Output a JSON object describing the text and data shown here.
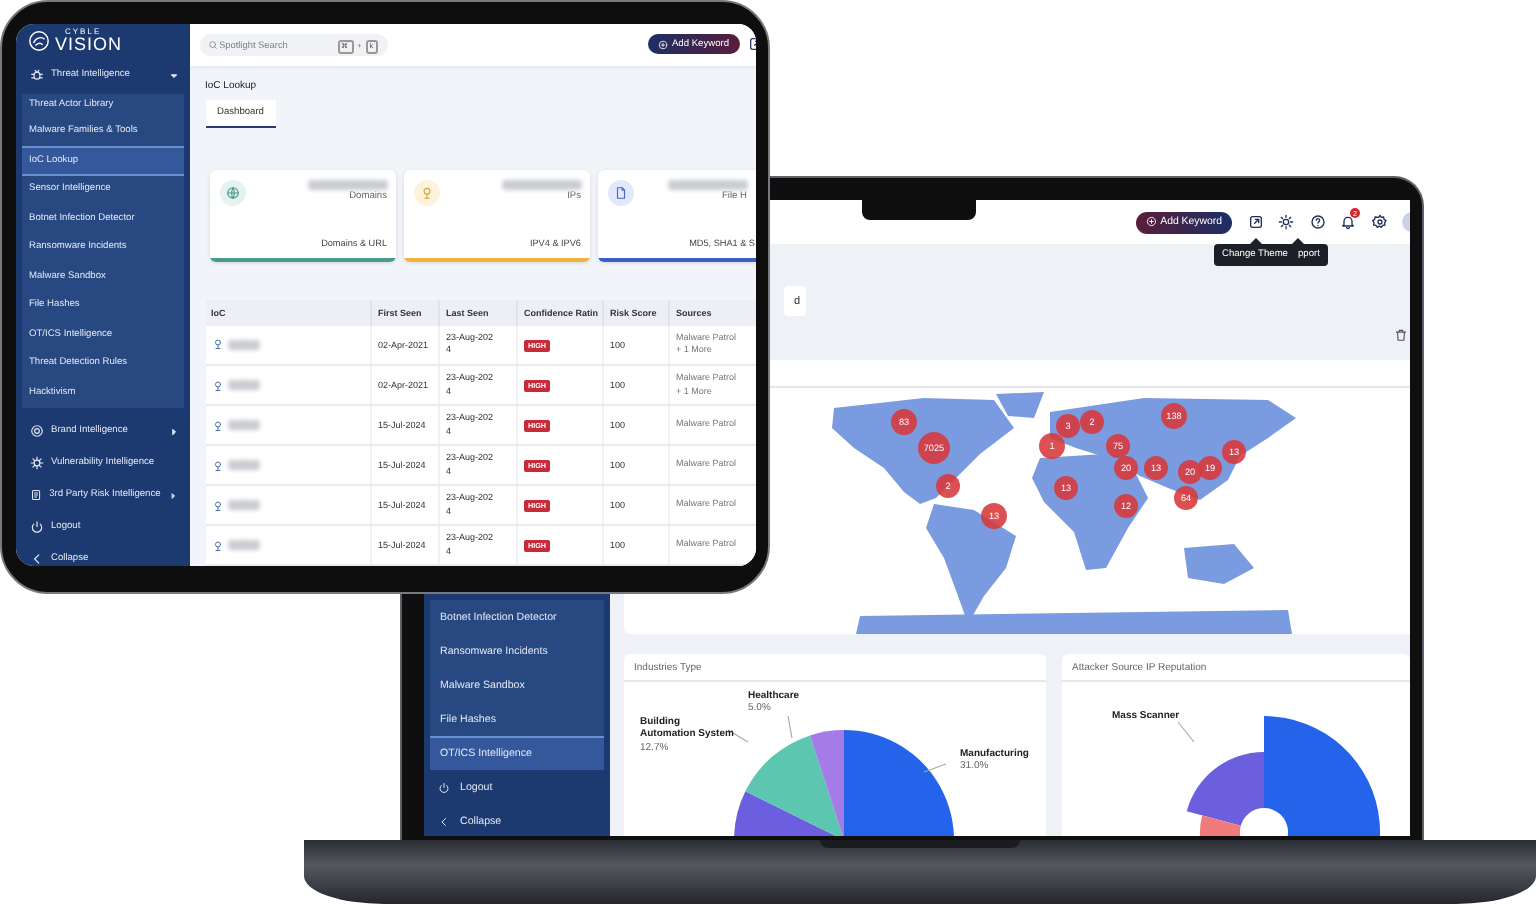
{
  "tablet": {
    "logo": {
      "tagline": "CYBLE",
      "name": "VISION"
    },
    "sidebar": {
      "items": [
        {
          "label": "Threat Intelligence",
          "kind": "group",
          "expanded": true,
          "selected": false,
          "children": [
            {
              "label": "Threat Actor Library",
              "selected": false
            },
            {
              "label": "Malware Families & Tools",
              "selected": false
            },
            {
              "label": "IoC Lookup",
              "selected": true
            },
            {
              "label": "Sensor Intelligence",
              "selected": false
            },
            {
              "label": "Botnet Infection Detector",
              "selected": false
            },
            {
              "label": "Ransomware Incidents",
              "selected": false
            },
            {
              "label": "Malware Sandbox",
              "selected": false
            },
            {
              "label": "File Hashes",
              "selected": false
            },
            {
              "label": "OT/ICS Intelligence",
              "selected": false
            },
            {
              "label": "Threat Detection Rules",
              "selected": false
            },
            {
              "label": "Hacktivism",
              "selected": false
            }
          ]
        },
        {
          "label": "Brand Intelligence",
          "kind": "group",
          "expanded": false,
          "selected": false
        },
        {
          "label": "Vulnerability Intelligence",
          "kind": "link",
          "selected": false
        },
        {
          "label": "3rd Party Risk Intelligence",
          "kind": "group",
          "expanded": false,
          "selected": false
        },
        {
          "label": "Logout",
          "kind": "action",
          "selected": false
        },
        {
          "label": "Collapse",
          "kind": "action",
          "selected": false
        }
      ]
    },
    "search": {
      "placeholder": "Spotlight Search",
      "keys": [
        "⌘",
        "k"
      ],
      "key_separator": "+"
    },
    "add_keyword_button": "Add Keyword",
    "page_title": "IoC Lookup",
    "tabs": [
      {
        "label": "Dashboard",
        "selected": true
      }
    ],
    "cards": [
      {
        "kind": "domain",
        "label": "Domains",
        "footer": "Domains & URL",
        "color": "#4a9a8a"
      },
      {
        "kind": "ip",
        "label": "IPs",
        "footer": "IPV4 & IPV6",
        "color": "#f0b43c"
      },
      {
        "kind": "file",
        "label": "File H",
        "footer": "MD5, SHA1 & S",
        "color": "#3b5fc4"
      }
    ],
    "table": {
      "columns": [
        "IoC",
        "First Seen",
        "Last Seen",
        "Confidence Ratin",
        "Risk Score",
        "Sources"
      ],
      "rows": [
        {
          "first_seen": "02-Apr-2021",
          "last_seen": "23-Aug-2024",
          "confidence": "HIGH",
          "risk_score": "100",
          "sources": "Malware Patrol",
          "more": "+ 1 More"
        },
        {
          "first_seen": "02-Apr-2021",
          "last_seen": "23-Aug-2024",
          "confidence": "HIGH",
          "risk_score": "100",
          "sources": "Malware Patrol",
          "more": "+ 1 More"
        },
        {
          "first_seen": "15-Jul-2024",
          "last_seen": "23-Aug-2024",
          "confidence": "HIGH",
          "risk_score": "100",
          "sources": "Malware Patrol"
        },
        {
          "first_seen": "15-Jul-2024",
          "last_seen": "23-Aug-2024",
          "confidence": "HIGH",
          "risk_score": "100",
          "sources": "Malware Patrol"
        },
        {
          "first_seen": "15-Jul-2024",
          "last_seen": "23-Aug-2024",
          "confidence": "HIGH",
          "risk_score": "100",
          "sources": "Malware Patrol"
        },
        {
          "first_seen": "15-Jul-2024",
          "last_seen": "23-Aug-2024",
          "confidence": "HIGH",
          "risk_score": "100",
          "sources": "Malware Patrol"
        }
      ]
    }
  },
  "laptop": {
    "top_bar": {
      "add_keyword_button": "Add Keyword",
      "notification_count": "2",
      "tooltips": [
        "Change Theme",
        "pport"
      ]
    },
    "sidebar": {
      "items": [
        {
          "label": "Botnet Infection Detector",
          "kind": "link",
          "selected": false
        },
        {
          "label": "Ransomware Incidents",
          "kind": "link",
          "selected": false
        },
        {
          "label": "Malware Sandbox",
          "kind": "link",
          "selected": false
        },
        {
          "label": "File Hashes",
          "kind": "link",
          "selected": false
        },
        {
          "label": "OT/ICS Intelligence",
          "kind": "link",
          "selected": true
        },
        {
          "label": "Logout",
          "kind": "action",
          "selected": false
        },
        {
          "label": "Collapse",
          "kind": "action",
          "selected": false
        }
      ]
    },
    "tab_fragment": "d",
    "map": {
      "markers": [
        "83",
        "7025",
        "2",
        "13",
        "1",
        "3",
        "2",
        "75",
        "20",
        "13",
        "12",
        "138",
        "13",
        "20",
        "19",
        "13",
        "64"
      ]
    },
    "industries": {
      "title": "Industries Type",
      "labels": [
        {
          "name": "Healthcare",
          "value": "5.0%"
        },
        {
          "name": "Building Automation System",
          "value": "12.7%"
        },
        {
          "name": "Manufacturing",
          "value": "31.0%"
        }
      ]
    },
    "reputation": {
      "title": "Attacker Source IP Reputation",
      "labels": [
        {
          "name": "Mass Scanner"
        }
      ]
    }
  }
}
